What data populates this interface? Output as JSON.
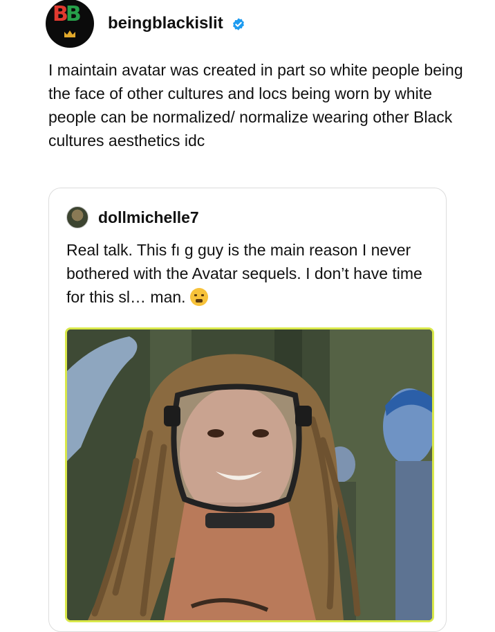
{
  "post": {
    "username": "beingblackislit",
    "verified": true,
    "avatar_letters": "BB",
    "caption": "I maintain avatar was created in part so white people being the face of other cultures and locs being worn by white people can be normalized/ normalize wearing other Black cultures aesthetics idc"
  },
  "quoted_post": {
    "username": "dollmichelle7",
    "text": "Real talk. This fı      g guy is the main reason I never bothered with the Avatar sequels. I don’t have time for this sl… man.",
    "emoji": "face-with-steam-from-nose",
    "image_alt": "photo of young man with long dreadlocks wearing a clear breathing mask, blue-skinned Na'vi characters in the background"
  },
  "colors": {
    "verified_blue": "#1d9bf0",
    "photo_border": "#d9e84a",
    "card_border": "#dcdcdc",
    "logo_red": "#e03a2f",
    "logo_green": "#27a04a",
    "logo_gold": "#e2a92b"
  }
}
